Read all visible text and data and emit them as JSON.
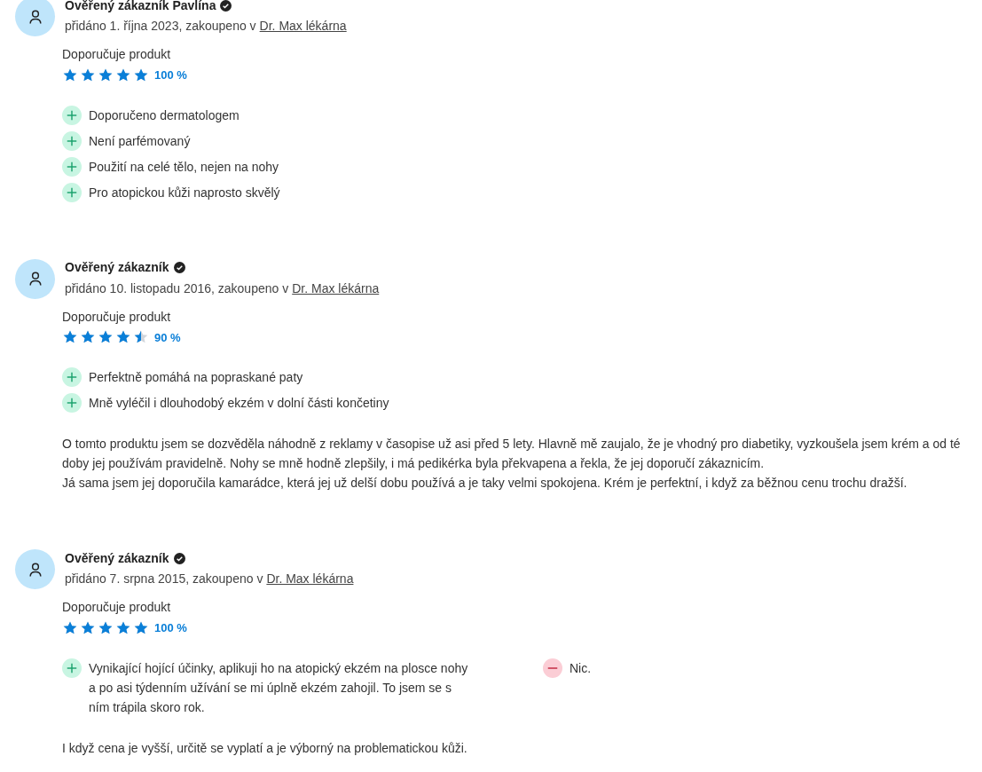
{
  "reviews": [
    {
      "author": "Ověřený zákazník Pavlína",
      "verified": true,
      "added": "přidáno 1. října 2023, zakoupeno v",
      "shop": "Dr. Max lékárna",
      "recommend": "Doporučuje produkt",
      "stars": 5,
      "percent": "100 %",
      "pros": [
        "Doporučeno dermatologem",
        "Není parfémovaný",
        "Použití na celé tělo, nejen na nohy",
        "Pro atopickou kůži naprosto skvělý"
      ]
    },
    {
      "author": "Ověřený zákazník",
      "verified": true,
      "added": "přidáno 10. listopadu 2016, zakoupeno v",
      "shop": "Dr. Max lékárna",
      "recommend": "Doporučuje produkt",
      "stars": 4.5,
      "percent": "90 %",
      "pros": [
        "Perfektně pomáhá na popraskané paty",
        "Mně vyléčil i dlouhodobý ekzém v dolní části končetiny"
      ],
      "text": [
        "O tomto produktu jsem se dozvěděla náhodně z reklamy v časopise už asi před 5 lety. Hlavně mě zaujalo, že je vhodný pro diabetiky, vyzkoušela jsem krém a od té doby jej používám pravidelně. Nohy se mně hodně zlepšily, i má pedikérka byla překvapena a řekla, že jej doporučí zákaznicím.",
        "Já sama jsem jej doporučila kamarádce, která jej už delší dobu používá a je taky velmi spokojena. Krém je perfektní, i když za běžnou cenu trochu dražší."
      ]
    },
    {
      "author": "Ověřený zákazník",
      "verified": true,
      "added": "přidáno 7. srpna 2015, zakoupeno v",
      "shop": "Dr. Max lékárna",
      "recommend": "Doporučuje produkt",
      "stars": 5,
      "percent": "100 %",
      "pros": [
        "Vynikající hojící účinky, aplikuji ho na atopický ekzém na plosce nohy a po asi týdenním užívání se mi úplně ekzém zahojil. To jsem se s ním trápila skoro rok."
      ],
      "cons": [
        "Nic."
      ],
      "text": [
        "I když cena je vyšší, určitě se vyplatí a je výborný na problematickou kůži."
      ]
    }
  ]
}
